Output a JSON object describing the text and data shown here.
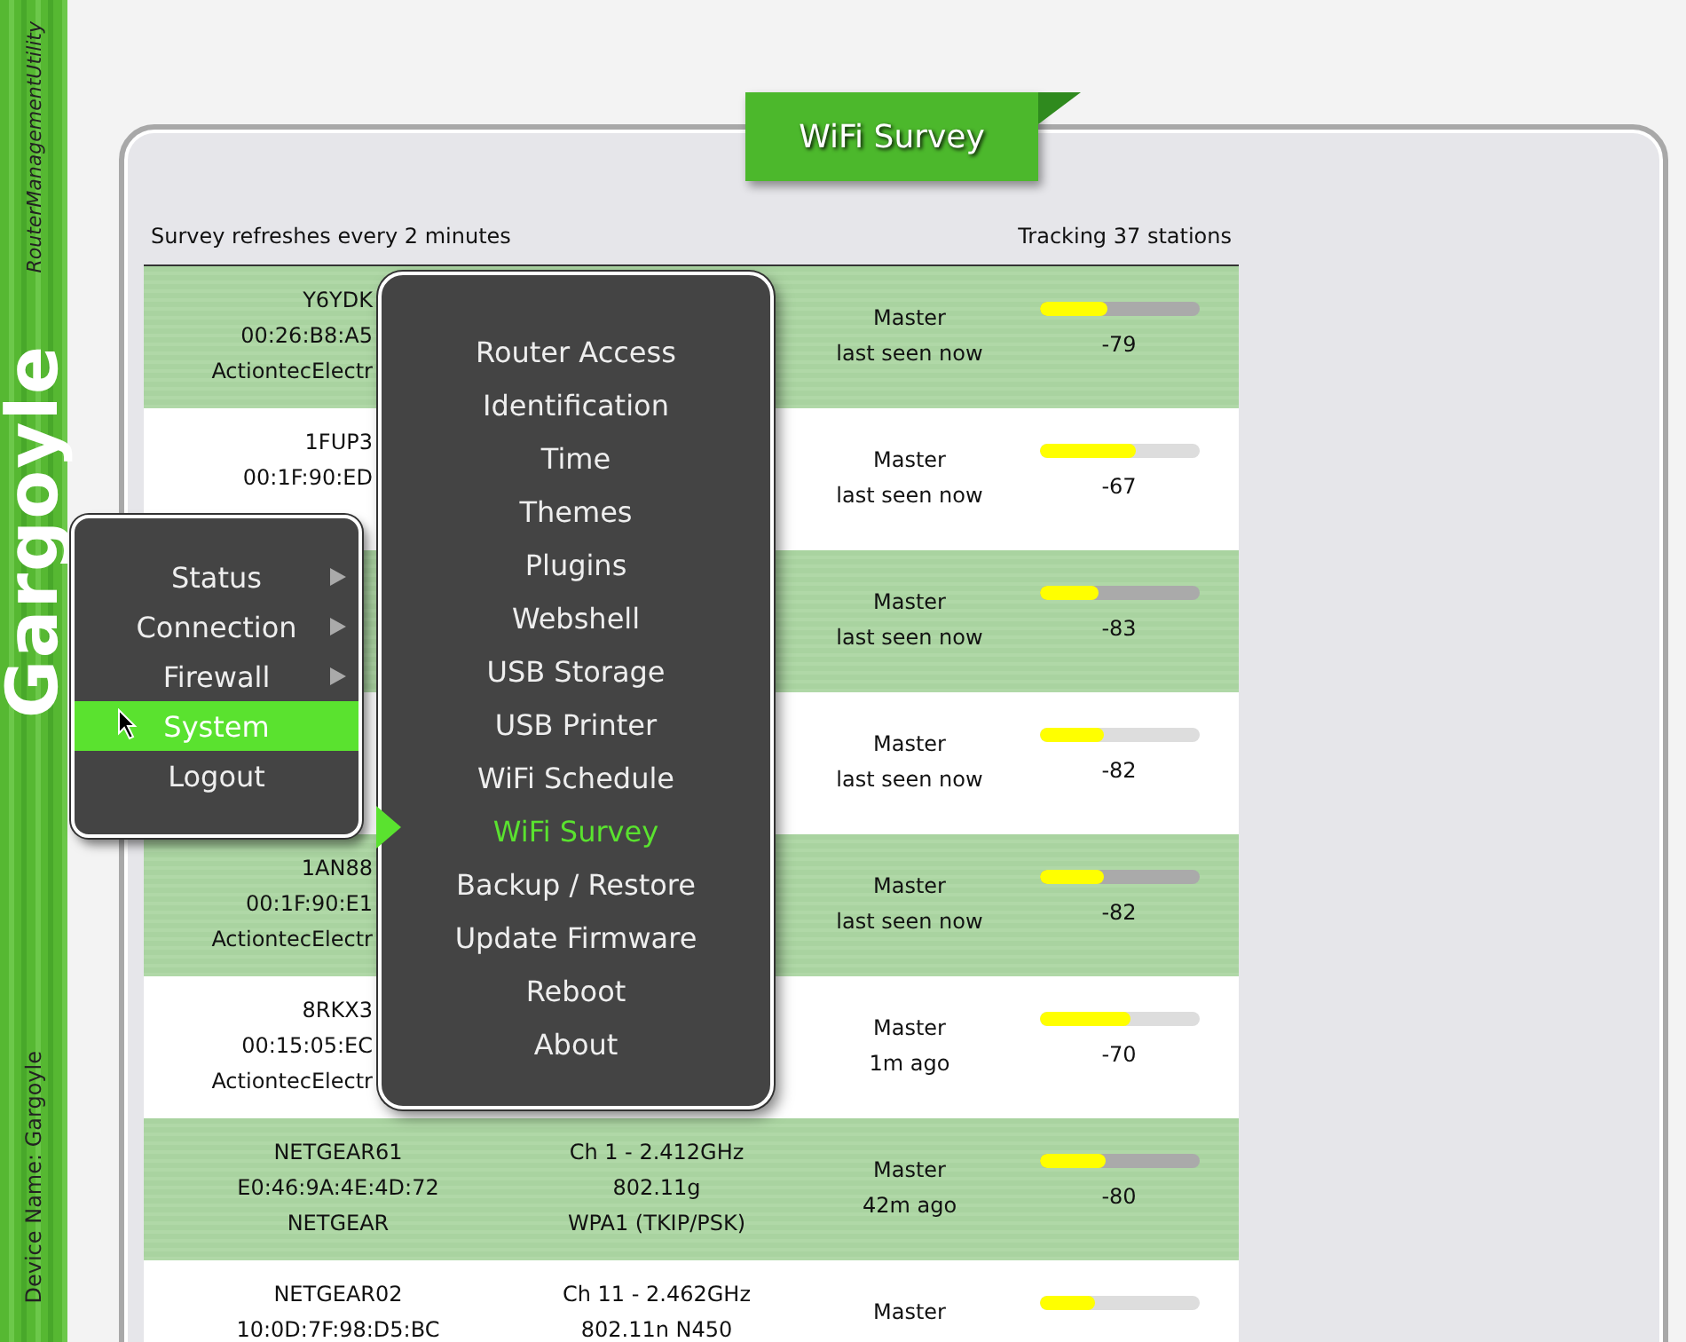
{
  "sidebar": {
    "tagline": "RouterManagementUtility",
    "logo": "Gargoyle",
    "device_name": "Device Name: Gargoyle"
  },
  "page_title": "WiFi Survey",
  "survey": {
    "refresh_note": "Survey refreshes every 2 minutes",
    "tracking": "Tracking 37 stations"
  },
  "stations": [
    {
      "ssid": "Y6YDK",
      "mac": "00:26:B8:A5",
      "vendor": "ActiontecElectr",
      "role": "Master",
      "seen": "last seen now",
      "level": 0.43,
      "rssi": "-79"
    },
    {
      "ssid": "1FUP3",
      "mac": "00:1F:90:ED",
      "role": "Master",
      "seen": "last seen now",
      "level": 0.61,
      "rssi": "-67"
    },
    {
      "role": "Master",
      "seen": "last seen now",
      "level": 0.37,
      "rssi": "-83"
    },
    {
      "role": "Master",
      "seen": "last seen now",
      "level": 0.4,
      "rssi": "-82"
    },
    {
      "ssid": "1AN88",
      "mac": "00:1F:90:E1",
      "vendor": "ActiontecElectr",
      "role": "Master",
      "seen": "last seen now",
      "level": 0.4,
      "rssi": "-82"
    },
    {
      "ssid": "8RKX3",
      "mac": "00:15:05:EC",
      "vendor": "ActiontecElectr",
      "role": "Master",
      "seen": "1m ago",
      "level": 0.57,
      "rssi": "-70"
    },
    {
      "ssid": "NETGEAR61",
      "mac": "E0:46:9A:4E:4D:72",
      "vendor": "NETGEAR",
      "channel": "Ch 1 - 2.412GHz",
      "mode": "802.11g",
      "security": "WPA1 (TKIP/PSK)",
      "role": "Master",
      "seen": "42m ago",
      "level": 0.42,
      "rssi": "-80"
    },
    {
      "ssid": "NETGEAR02",
      "mac": "10:0D:7F:98:D5:BC",
      "channel": "Ch 11 - 2.462GHz",
      "mode": "802.11n N450",
      "role": "Master",
      "level": 0.35
    }
  ],
  "menu": {
    "items": [
      {
        "label": "Status",
        "has_submenu": true,
        "selected": false
      },
      {
        "label": "Connection",
        "has_submenu": true,
        "selected": false
      },
      {
        "label": "Firewall",
        "has_submenu": true,
        "selected": false
      },
      {
        "label": "System",
        "has_submenu": false,
        "selected": true
      },
      {
        "label": "Logout",
        "has_submenu": false,
        "selected": false
      }
    ]
  },
  "submenu": {
    "items": [
      {
        "label": "Router Access",
        "selected": false
      },
      {
        "label": "Identification",
        "selected": false
      },
      {
        "label": "Time",
        "selected": false
      },
      {
        "label": "Themes",
        "selected": false
      },
      {
        "label": "Plugins",
        "selected": false
      },
      {
        "label": "Webshell",
        "selected": false
      },
      {
        "label": "USB Storage",
        "selected": false
      },
      {
        "label": "USB Printer",
        "selected": false
      },
      {
        "label": "WiFi Schedule",
        "selected": false
      },
      {
        "label": "WiFi Survey",
        "selected": true
      },
      {
        "label": "Backup / Restore",
        "selected": false
      },
      {
        "label": "Update Firmware",
        "selected": false
      },
      {
        "label": "Reboot",
        "selected": false
      },
      {
        "label": "About",
        "selected": false
      }
    ]
  }
}
